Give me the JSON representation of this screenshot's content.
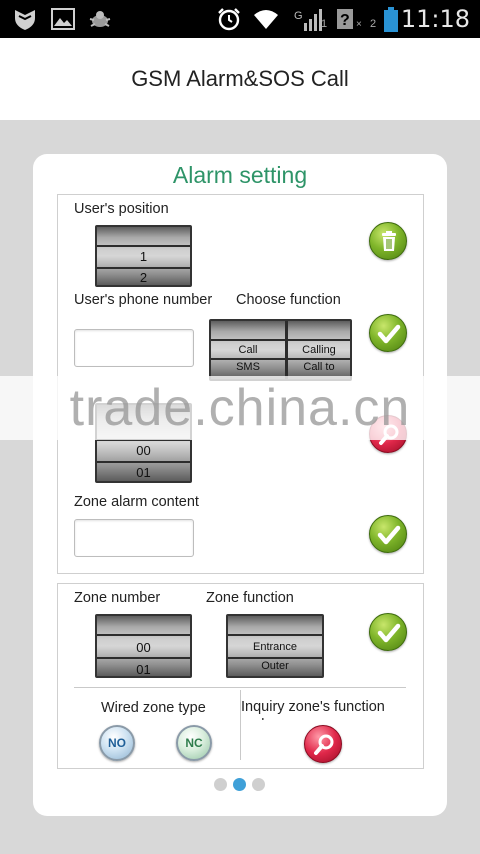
{
  "status_bar": {
    "time": "11:18",
    "icons": [
      "shield-icon",
      "image-icon",
      "bug-icon",
      "alarm-clock-icon",
      "wifi-icon",
      "signal-icon",
      "sim-unknown-icon",
      "battery-icon"
    ],
    "signal_mini_1": "1",
    "signal_mini_2": "2"
  },
  "header": {
    "title": "GSM Alarm&SOS Call"
  },
  "card": {
    "title": "Alarm setting",
    "title_color": "#2e9468"
  },
  "section1": {
    "user_position_label": "User's position",
    "user_position_picker": [
      "1",
      "2"
    ],
    "user_phone_label": "User's phone number",
    "user_phone_value": "",
    "choose_function_label": "Choose function",
    "function_picker_left": [
      "Call",
      "SMS"
    ],
    "function_picker_right": [
      "Calling",
      "Call to"
    ],
    "hidden_picker": [
      "00",
      "01"
    ],
    "zone_alarm_content_label": "Zone alarm content",
    "zone_alarm_content_value": ""
  },
  "section2": {
    "zone_number_label": "Zone number",
    "zone_number_picker": [
      "00",
      "01"
    ],
    "zone_function_label": "Zone function",
    "zone_function_picker": [
      "Entrance",
      "Outer"
    ],
    "wired_zone_type_label": "Wired zone type",
    "no_button": "NO",
    "nc_button": "NC",
    "inquiry_label": "Inquiry zone's function code"
  },
  "watermark": "trade.china.cn",
  "pager": {
    "count": 3,
    "active": 1
  }
}
